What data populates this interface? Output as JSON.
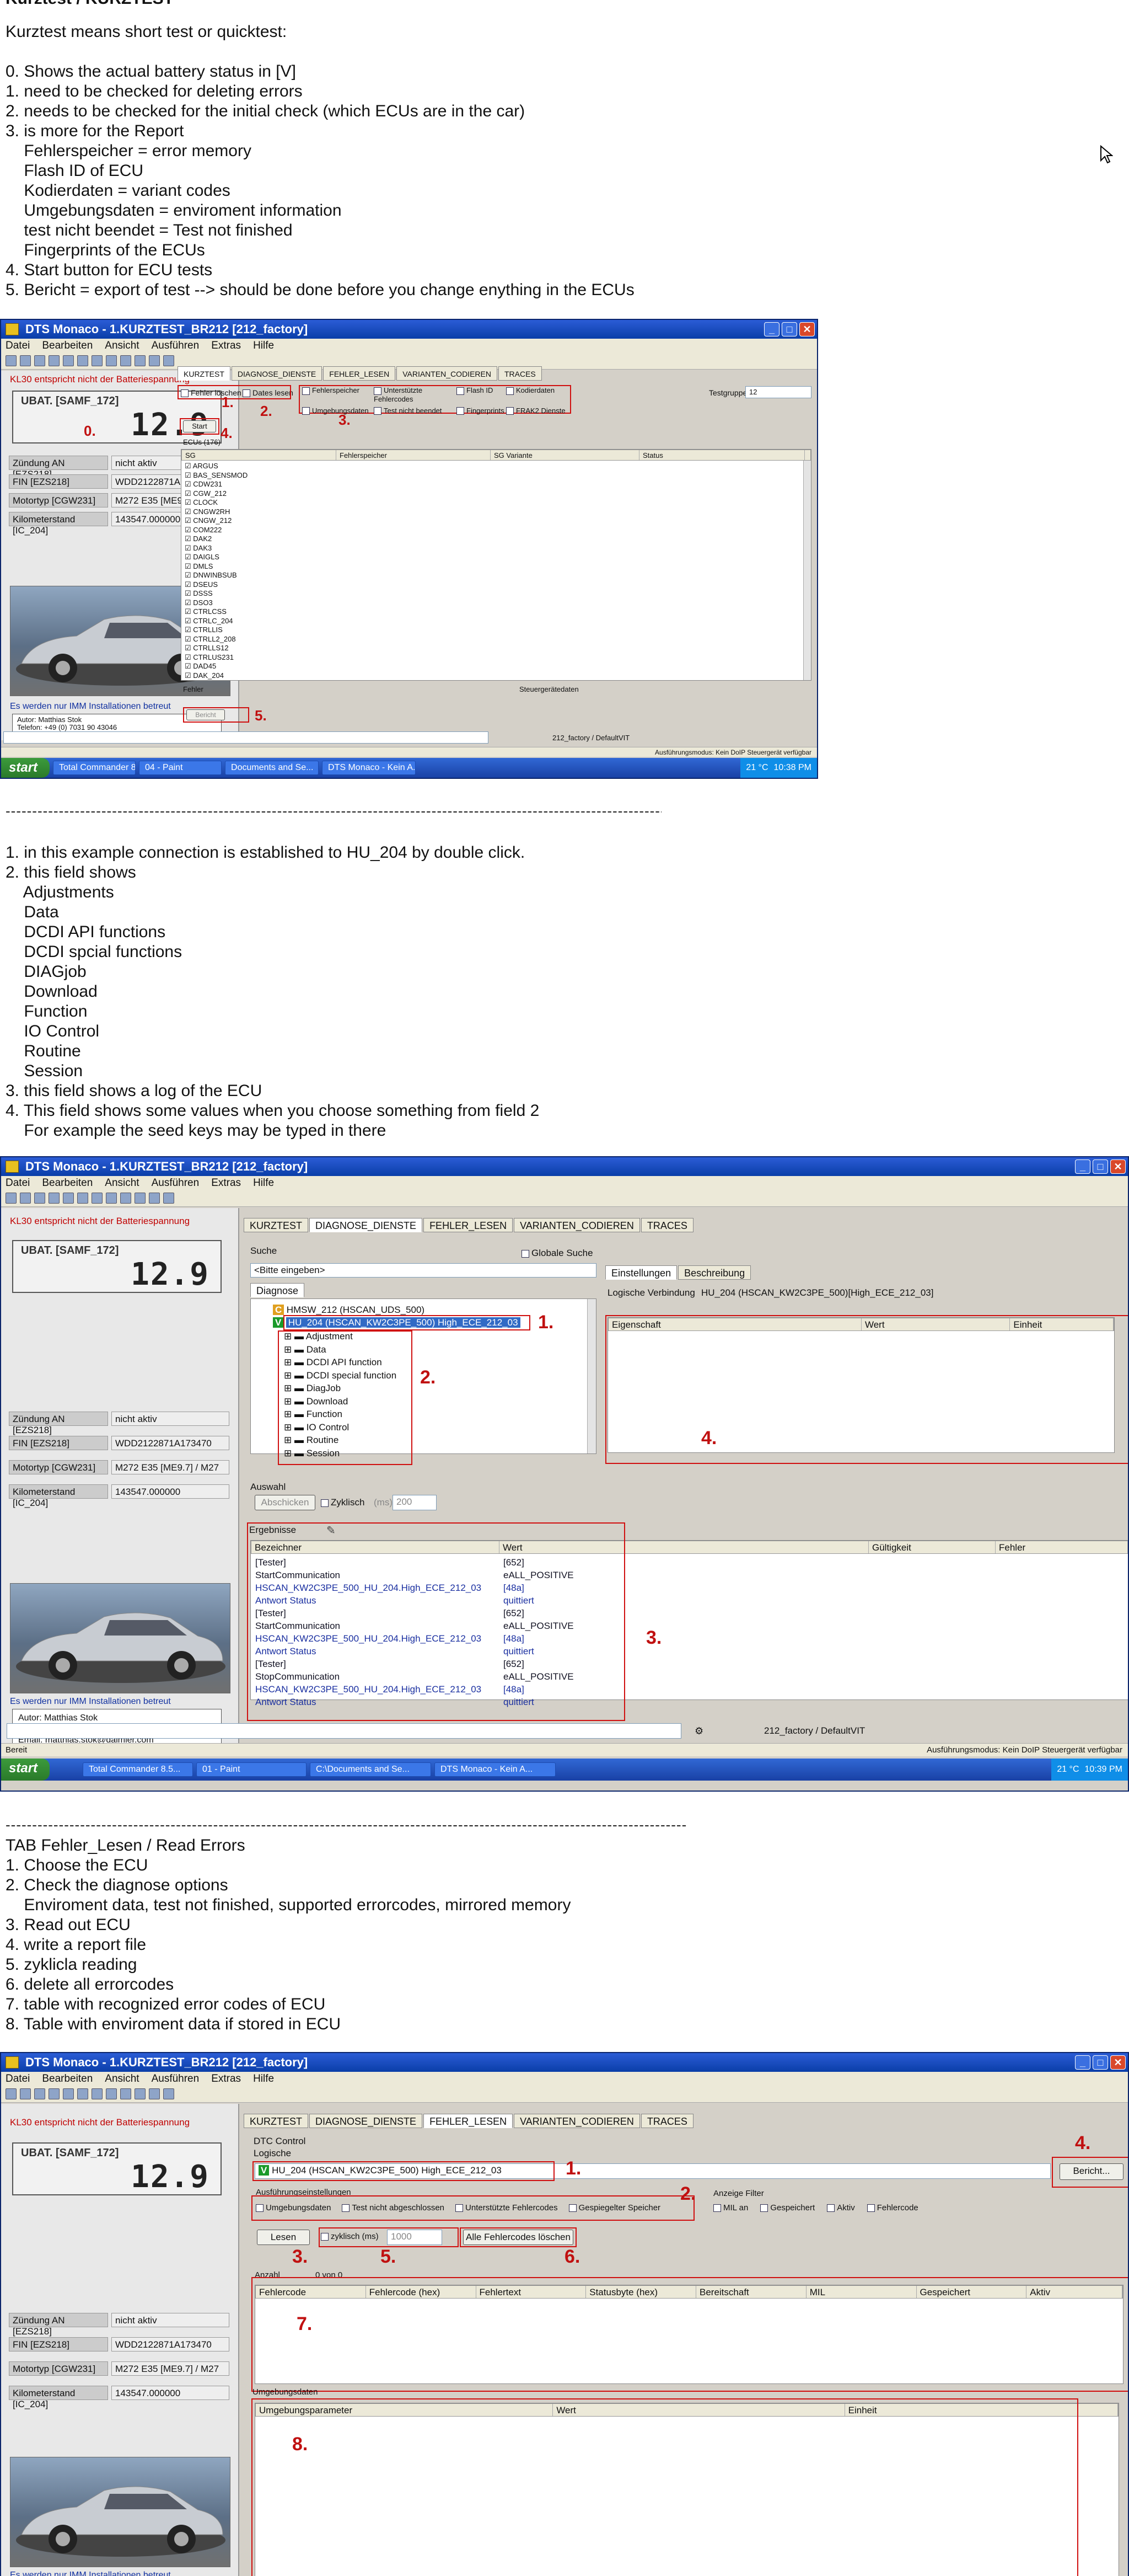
{
  "doc": {
    "heading_top": "Kurztest / KURZTEST",
    "section1": {
      "intro": "Kurztest means short test or quicktest:",
      "items": [
        "0. Shows the actual battery status in [V]",
        "1. need to be checked for deleting errors",
        "2. needs to be checked for the initial check (which ECUs are in the car)",
        "3. is more for the Report",
        "    Fehlerspeicher = error memory",
        "    Flash ID of ECU",
        "    Kodierdaten = variant codes",
        "    Umgebungsdaten = enviroment information",
        "    test nicht beendet = Test not finished",
        "    Fingerprints of the ECUs",
        "4. Start button for ECU tests",
        "5. Bericht = export of test --> should be done before you change enything in the ECUs"
      ]
    },
    "separator": "-------------------------------------------------------------------------------------------------------------------------------------------------------------",
    "section2": {
      "items": [
        "1. in this example connection is established to HU_204 by double click.",
        "2. this field shows",
        "    Adjustments",
        "    Data",
        "    DCDI API functions",
        "    DCDI spcial functions",
        "    DIAGjob",
        "    Download",
        "    Function",
        "    IO Control",
        "    Routine",
        "    Session",
        "3. this field shows a log of the ECU",
        "4. This field shows some values when you choose something from field 2",
        "    For example the seed keys may be typed in there"
      ]
    },
    "section3": {
      "items": [
        "TAB Fehler_Lesen / Read Errors",
        "1. Choose the ECU",
        "2. Check the diagnose options",
        "    Enviroment data, test not finished, supported errorcodes, mirrored memory",
        "3. Read out ECU",
        "4. write a report file",
        "5. zyklicla reading",
        "6. delete all errorcodes",
        "7. table with recognized error codes of ECU",
        "8. Table with enviroment data if stored in ECU"
      ]
    }
  },
  "app": {
    "title1": "DTS Monaco - 1.KURZTEST_BR212 [212_factory]",
    "title2": "DTS Monaco - 1.KURZTEST_BR212 [212_factory]",
    "title3": "DTS Monaco - 1.KURZTEST_BR212 [212_factory]",
    "menu": [
      "Datei",
      "Bearbeiten",
      "Ansicht",
      "Ausführen",
      "Extras",
      "Hilfe"
    ],
    "tabs": [
      "KURZTEST",
      "DIAGNOSE_DIENSTE",
      "FEHLER_LESEN",
      "VARIANTEN_CODIEREN",
      "TRACES"
    ],
    "left": {
      "warning": "KL30 entspricht nicht der Batteriespannung",
      "ubat_label": "UBAT. [SAMF_172]",
      "ubat_value": "12.9",
      "info": [
        {
          "k": "Zündung AN [EZS218]",
          "v": "nicht aktiv"
        },
        {
          "k": "FIN [EZS218]",
          "v": "WDD2122871A173470"
        },
        {
          "k": "Motortyp [CGW231]",
          "v": "M272 E35 [ME9.7] / M27"
        },
        {
          "k": "Kilometerstand [IC_204]",
          "v": "143547.000000"
        }
      ],
      "imm_note": "Es werden nur IMM Installationen betreut",
      "author": [
        {
          "k": "Autor:",
          "v": "Matthias Stok"
        },
        {
          "k": "Telefon:",
          "v": "+49 (0) 7031 90 43046"
        },
        {
          "k": "Email:",
          "v": "matthias.stok@daimler.com"
        }
      ]
    },
    "kurztest": {
      "checks": [
        "Fehler löschen",
        "Dates lesen"
      ],
      "options": [
        "Fehlerspeicher",
        "Unterstützte Fehlercodes",
        "Flash ID",
        "Kodierdaten",
        "Umgebungsdaten",
        "Test nicht beendet",
        "Fingerprints",
        "FRAK2 Dienste"
      ],
      "testgruppe_label": "Testgruppe",
      "testgruppe_value": "12",
      "start": "Start",
      "ecu_count": "ECUs (176)",
      "cols": [
        "SG",
        "Fehlerspeicher",
        "SG Variante",
        "Status"
      ],
      "ecus": [
        "ARGUS",
        "BAS_SENSMOD",
        "CDW231",
        "CGW_212",
        "CLOCK",
        "CNGW2RH",
        "CNGW_212",
        "COM222",
        "DAK2",
        "DAK3",
        "DAIGLS",
        "DMLS",
        "DNWINBSUB",
        "DSEUS",
        "DSSS",
        "DSO3",
        "CTRLCSS",
        "CTRLC_204",
        "CTRLLIS",
        "CTRLL2_208",
        "CTRLLS12",
        "CTRLUS231",
        "DAD45",
        "DAK_204"
      ],
      "fehler_label": "Fehler",
      "steuergeraete_label": "Steuergerätedaten",
      "bericht": "Bericht",
      "status_right": "Ausführungsmodus: Kein DoIP Steuergerät verfügbar"
    },
    "dienste": {
      "suche_label": "Suche",
      "global_search": "Globale Suche",
      "suche_placeholder": "<Bitte eingeben>",
      "diagnose_tab": "Diagnose",
      "tree_root1": "HMSW_212 (HSCAN_UDS_500)",
      "tree_root2": "HU_204 (HSCAN_KW2C3PE_500) High_ECE_212_03",
      "tree_items": [
        "Adjustment",
        "Data",
        "DCDI API function",
        "DCDI special function",
        "DiagJob",
        "Download",
        "Function",
        "IO Control",
        "Routine",
        "Session"
      ],
      "right_tabs": [
        "Einstellungen",
        "Beschreibung"
      ],
      "logische_label": "Logische Verbindung",
      "logische_value": "HU_204 (HSCAN_KW2C3PE_500)[High_ECE_212_03]",
      "prop_cols": [
        "Eigenschaft",
        "Wert",
        "Einheit"
      ],
      "auswahl": "Auswahl",
      "abschicken": "Abschicken",
      "zyklisch": "Zyklisch",
      "ms_label": "(ms)",
      "ms_value": "200",
      "ergebnisse": "Ergebnisse",
      "log_cols": [
        "Bezeichner",
        "Wert",
        "Gültigkeit",
        "Fehler"
      ],
      "log": [
        {
          "a": "[Tester]",
          "b": "[652]"
        },
        {
          "a": "StartCommunication",
          "b": "eALL_POSITIVE"
        },
        {
          "a": "HSCAN_KW2C3PE_500_HU_204.High_ECE_212_03",
          "b": "[48a]"
        },
        {
          "a": "Antwort Status",
          "b": "quittiert"
        },
        {
          "a": "[Tester]",
          "b": "[652]"
        },
        {
          "a": "StartCommunication",
          "b": "eALL_POSITIVE"
        },
        {
          "a": "HSCAN_KW2C3PE_500_HU_204.High_ECE_212_03",
          "b": "[48a]"
        },
        {
          "a": "Antwort Status",
          "b": "quittiert"
        },
        {
          "a": "[Tester]",
          "b": "[652]"
        },
        {
          "a": "StopCommunication",
          "b": "eALL_POSITIVE"
        },
        {
          "a": "HSCAN_KW2C3PE_500_HU_204.High_ECE_212_03",
          "b": "[48a]"
        },
        {
          "a": "Antwort Status",
          "b": "quittiert"
        }
      ],
      "bottom_path": "212_factory / DefaultVIT",
      "bereit": "Bereit",
      "status_right": "Ausführungsmodus: Kein DoIP Steuergerät verfügbar"
    },
    "fehler": {
      "dtc_control": "DTC Control",
      "logische": "Logische",
      "ecu_value": "HU_204 (HSCAN_KW2C3PE_500) High_ECE_212_03",
      "bericht": "Bericht...",
      "ausf_label": "Ausführungseinstellungen",
      "ausf_options": [
        "Umgebungsdaten",
        "Test nicht abgeschlossen",
        "Unterstützte Fehlercodes",
        "Gespiegelter Speicher"
      ],
      "anzeige_label": "Anzeige Filter",
      "anzeige_options": [
        "MIL an",
        "Gespeichert",
        "Aktiv",
        "Fehlercode"
      ],
      "lesen": "Lesen",
      "zyklisch": "zyklisch (ms)",
      "ms_value": "1000",
      "alle_loeschen": "Alle Fehlercodes löschen",
      "anzahl": "Anzahl",
      "anzahl_value": "0 von 0",
      "dtc_cols": [
        "Fehlercode",
        "Fehlercode (hex)",
        "Fehlertext",
        "Statusbyte (hex)",
        "Bereitschaft",
        "MIL",
        "Gespeichert",
        "Aktiv"
      ],
      "umgebung_label": "Umgebungsdaten",
      "env_cols": [
        "Umgebungsparameter",
        "Wert",
        "Einheit"
      ]
    },
    "taskbar": {
      "start": "start",
      "tasks1": [
        "Total Commander 8.5...",
        "04 - Paint",
        "Documents and Se...",
        "DTS Monaco - Kein A..."
      ],
      "tasks2": [
        "Total Commander 8.5...",
        "01 - Paint",
        "C:\\Documents and Se...",
        "DTS Monaco - Kein A..."
      ],
      "temp": "21 °C",
      "clock1": "10:38 PM",
      "clock2": "10:39 PM"
    },
    "annotations": [
      "0.",
      "1.",
      "2.",
      "3.",
      "4.",
      "5.",
      "6.",
      "7.",
      "8."
    ]
  },
  "colors": {
    "annotation": "#d01010",
    "titlebar": "#0a3ea8",
    "warning": "#c00000",
    "ecu_green": "#1a9a2a"
  }
}
